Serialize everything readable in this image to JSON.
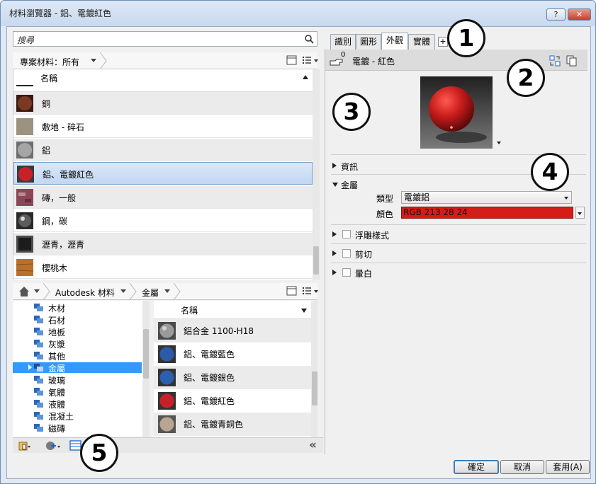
{
  "window": {
    "title": "材料瀏覽器 - 鋁、電鍍紅色",
    "help_label": "?",
    "close_label": "✕"
  },
  "search": {
    "placeholder": "搜尋"
  },
  "project_filter": {
    "label": "專案材料：所有"
  },
  "project_list": {
    "header": "名稱",
    "rows": [
      {
        "label": "銅",
        "swatch": "#7a3a22"
      },
      {
        "label": "敷地 - 碎石",
        "swatch": "#9c9280"
      },
      {
        "label": "鋁",
        "swatch": "#a5a5a5"
      },
      {
        "label": "鋁、電鍍紅色",
        "swatch": "#c8202a"
      },
      {
        "label": "磚，一般",
        "swatch": "#8d4656"
      },
      {
        "label": "鋼，碳",
        "swatch": "#5c5c5c"
      },
      {
        "label": "瀝青，瀝青",
        "swatch": "#1c1c1c"
      },
      {
        "label": "櫻桃木",
        "swatch": "#b8702c"
      }
    ]
  },
  "library_bar": {
    "root": "Autodesk 材料",
    "category": "金屬"
  },
  "tree": {
    "items": [
      "木材",
      "石材",
      "地板",
      "灰漿",
      "其他",
      "金屬",
      "玻璃",
      "氣體",
      "液體",
      "混凝土",
      "磁磚"
    ]
  },
  "library_list": {
    "header": "名稱",
    "rows": [
      {
        "label": "鋁合金 1100-H18",
        "swatch": "#9a9a9a"
      },
      {
        "label": "鋁、電鍍藍色",
        "swatch": "#2c5aa8"
      },
      {
        "label": "鋁、電鍍銀色",
        "swatch": "#2c5fae"
      },
      {
        "label": "鋁、電鍍紅色",
        "swatch": "#c8202a"
      },
      {
        "label": "鋁、電鍍青銅色",
        "swatch": "#b9a592"
      }
    ]
  },
  "tabs": [
    "識別",
    "圖形",
    "外觀",
    "實體"
  ],
  "tab_add": "+",
  "asset": {
    "count": "0",
    "title": "電鍍 - 紅色"
  },
  "sections": {
    "info": "資訊",
    "metal": "金屬",
    "type_label": "類型",
    "type_value": "電鍍鋁",
    "color_label": "顏色",
    "color_value": "RGB 213 28 24",
    "color_hex": "#d51c18",
    "relief": "浮雕樣式",
    "cutout": "剪切",
    "tint": "暈白"
  },
  "footer": {
    "ok": "確定",
    "cancel": "取消",
    "apply": "套用(A)"
  },
  "callouts": [
    "1",
    "2",
    "3",
    "4",
    "5"
  ],
  "collapse_label": "«"
}
